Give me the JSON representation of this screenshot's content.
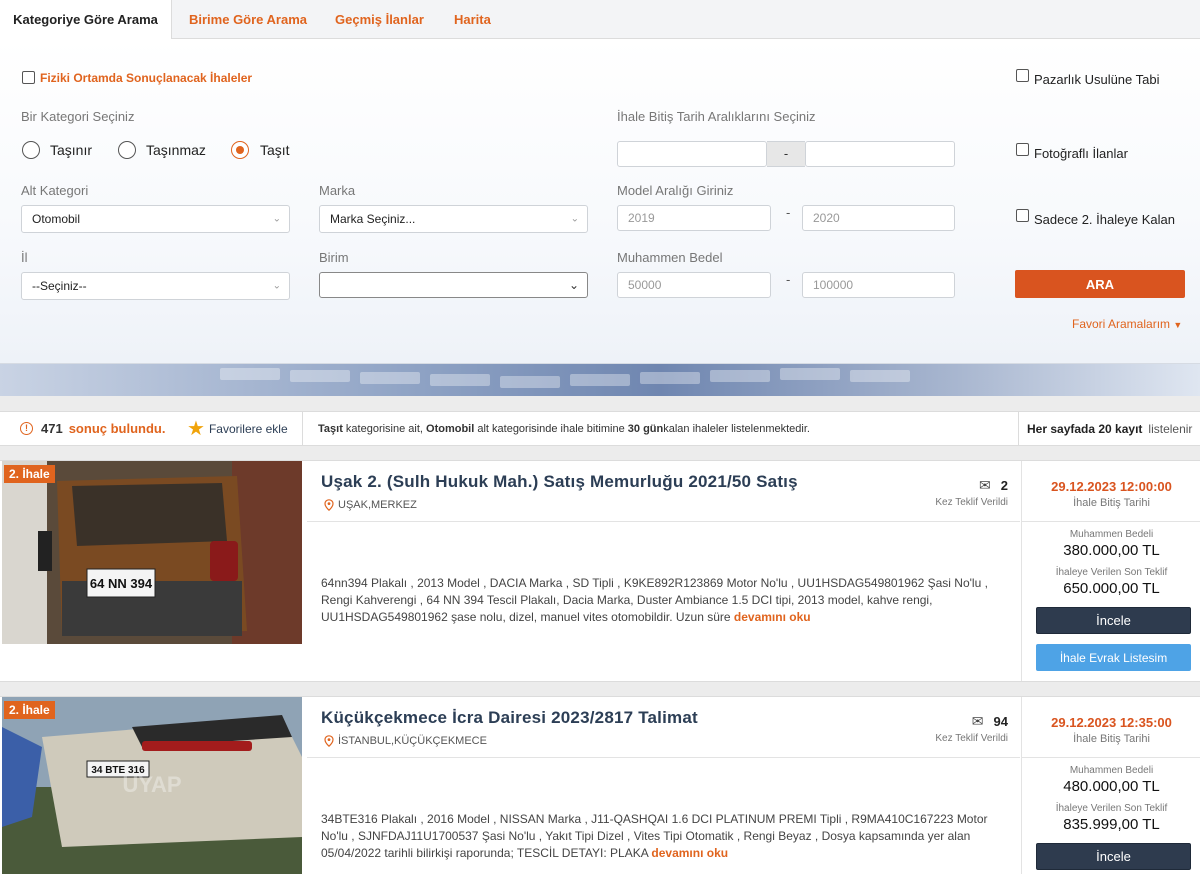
{
  "tabs": [
    "Kategoriye Göre Arama",
    "Birime Göre Arama",
    "Geçmiş İlanlar",
    "Harita"
  ],
  "filters": {
    "physical_label": "Fiziki Ortamda Sonuçlanacak İhaleler",
    "category_title": "Bir Kategori Seçiniz",
    "categories": [
      "Taşınır",
      "Taşınmaz",
      "Taşıt"
    ],
    "subcategory_label": "Alt Kategori",
    "subcategory_value": "Otomobil",
    "brand_label": "Marka",
    "brand_value": "Marka Seçiniz...",
    "province_label": "İl",
    "province_value": "--Seçiniz--",
    "unit_label": "Birim",
    "unit_value": "",
    "date_range_label": "İhale Bitiş Tarih Aralıklarını Seçiniz",
    "date_sep": "-",
    "model_range_label": "Model Aralığı Giriniz",
    "model_from": "2019",
    "model_to": "2020",
    "estimate_label": "Muhammen Bedel",
    "estimate_from": "50000",
    "estimate_to": "100000",
    "range_dash": "-",
    "bargain_label": "Pazarlık Usulüne Tabi",
    "photo_label": "Fotoğraflı İlanlar",
    "second_only_label": "Sadece 2. İhaleye Kalan",
    "search_button": "ARA",
    "favorites_link": "Favori Aramalarım"
  },
  "results_bar": {
    "count": "471",
    "found_text": "sonuç bulundu.",
    "add_fav": "Favorilere ekle",
    "info_b1": "Taşıt",
    "info_t1": " kategorisine ait, ",
    "info_b2": "Otomobil",
    "info_t2": " alt kategorisinde ihale bitimine ",
    "info_b3": "30 gün",
    "info_t3": " kalan ihaleler listelenmektedir.",
    "per_page": "Her sayfada 20 kayıt",
    "per_page_tail": "listelenir"
  },
  "listings": [
    {
      "badge": "2. İhale",
      "title": "Uşak 2. (Sulh Hukuk Mah.) Satış Memurluğu 2021/50 Satış",
      "location": "UŞAK,MERKEZ",
      "bid_count": "2",
      "bid_label": "Kez Teklif Verildi",
      "description": "64nn394 Plakalı , 2013 Model , DACIA Marka , SD Tipli , K9KE892R123869 Motor No'lu , UU1HSDAG549801962 Şasi No'lu , Rengi Kahverengi , 64 NN 394 Tescil Plakalı, Dacia Marka, Duster Ambiance 1.5 DCI tipi, 2013 model, kahve rengi, UU1HSDAG549801962 şase nolu, dizel, manuel vites otomobildir. Uzun süre",
      "more": "devamını oku",
      "end_date": "29.12.2023 12:00:00",
      "end_label": "İhale Bitiş Tarihi",
      "estimate_label": "Muhammen Bedeli",
      "estimate": "380.000,00 TL",
      "last_bid_label": "İhaleye Verilen Son Teklif",
      "last_bid": "650.000,00 TL",
      "inspect_button": "İncele",
      "docs_button": "İhale Evrak Listesim",
      "plate": "64 NN 394"
    },
    {
      "badge": "2. İhale",
      "title": "Küçükçekmece İcra Dairesi 2023/2817 Talimat",
      "location": "İSTANBUL,KÜÇÜKÇEKMECE",
      "bid_count": "94",
      "bid_label": "Kez Teklif Verildi",
      "description": "34BTE316 Plakalı , 2016 Model , NISSAN Marka , J11-QASHQAI 1.6 DCI PLATINUM PREMI Tipli , R9MA410C167223 Motor No'lu , SJNFDAJ11U1700537 Şasi No'lu , Yakıt Tipi Dizel , Vites Tipi Otomatik , Rengi Beyaz , Dosya kapsamında yer alan 05/04/2022 tarihli bilirkişi raporunda; TESCİL DETAYI: PLAKA",
      "more": "devamını oku",
      "end_date": "29.12.2023 12:35:00",
      "end_label": "İhale Bitiş Tarihi",
      "estimate_label": "Muhammen Bedeli",
      "estimate": "480.000,00 TL",
      "last_bid_label": "İhaleye Verilen Son Teklif",
      "last_bid": "835.999,00 TL",
      "inspect_button": "İncele",
      "plate": "34 BTE 316",
      "watermark": "UYAP"
    }
  ],
  "colors": {
    "accent": "#e0641e",
    "button_dark": "#2e3b4e",
    "button_blue": "#4ea3e6",
    "title": "#2c3e55"
  }
}
